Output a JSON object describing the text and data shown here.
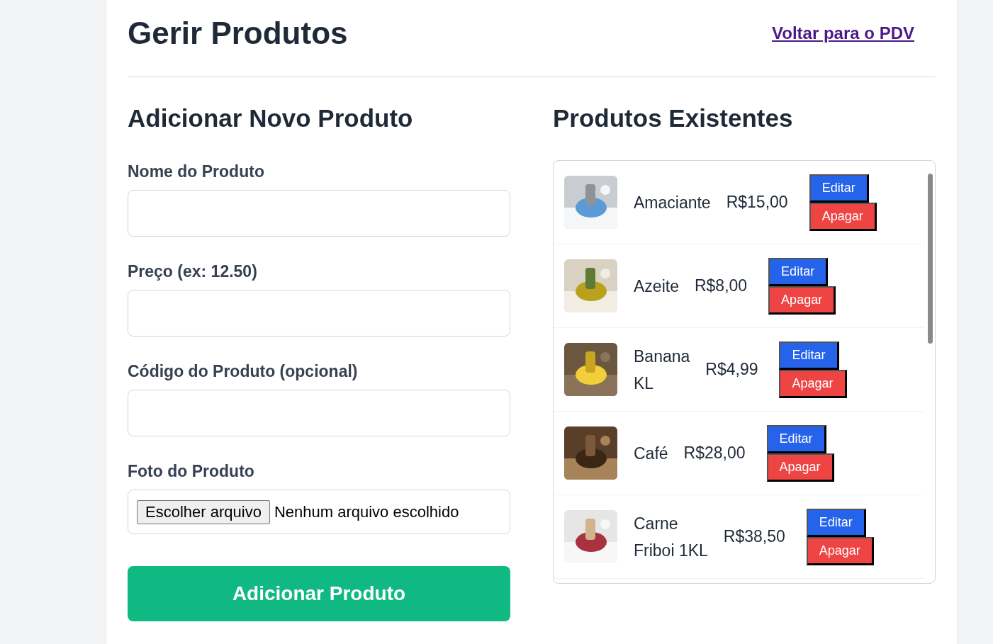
{
  "header": {
    "title": "Gerir Produtos",
    "back_link": "Voltar para o PDV"
  },
  "add_form": {
    "heading": "Adicionar Novo Produto",
    "fields": [
      {
        "kind": "text",
        "label": "Nome do Produto"
      },
      {
        "kind": "text",
        "label": "Preço (ex: 12.50)"
      },
      {
        "kind": "text",
        "label": "Código do Produto (opcional)"
      },
      {
        "kind": "file",
        "label": "Foto do Produto",
        "button": "Escolher arquivo",
        "status": "Nenhum arquivo escolhido"
      }
    ],
    "submit": "Adicionar Produto"
  },
  "products": {
    "heading": "Produtos Existentes",
    "items": [
      {
        "name": "Amaciante",
        "price": "R$15,00",
        "edit": "Editar",
        "delete": "Apagar"
      },
      {
        "name": "Azeite",
        "price": "R$8,00",
        "edit": "Editar",
        "delete": "Apagar"
      },
      {
        "name": "Banana\nKL",
        "price": "R$4,99",
        "edit": "Editar",
        "delete": "Apagar"
      },
      {
        "name": "Café",
        "price": "R$28,00",
        "edit": "Editar",
        "delete": "Apagar"
      },
      {
        "name": "Carne\nFriboi 1KL",
        "price": "R$38,50",
        "edit": "Editar",
        "delete": "Apagar"
      }
    ]
  }
}
